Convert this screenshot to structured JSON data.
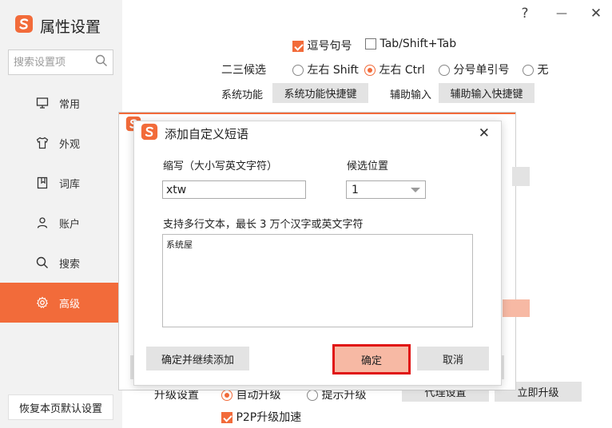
{
  "app": {
    "title": "属性设置",
    "help_glyph": "?",
    "minimize_glyph": "—",
    "close_glyph": "✕"
  },
  "sidebar": {
    "search_placeholder": "搜索设置项",
    "items": [
      {
        "label": "常用",
        "icon": "monitor-icon"
      },
      {
        "label": "外观",
        "icon": "shirt-icon"
      },
      {
        "label": "词库",
        "icon": "book-icon"
      },
      {
        "label": "账户",
        "icon": "person-icon"
      },
      {
        "label": "搜索",
        "icon": "search-icon"
      },
      {
        "label": "高级",
        "icon": "gear-icon"
      }
    ],
    "active_index": 5,
    "reset_label": "恢复本页默认设置"
  },
  "main": {
    "opt_comma_period": "逗号句号",
    "opt_tab_shift": "Tab/Shift+Tab",
    "candidate23_label": "二三候选",
    "radio_left_right_shift": "左右 Shift",
    "radio_left_right_ctrl": "左右 Ctrl",
    "radio_semicolon_quote": "分号单引号",
    "radio_none": "无",
    "sys_func_label": "系统功能",
    "sys_func_btn": "系统功能快捷键",
    "assist_input_label": "辅助输入",
    "assist_input_btn": "辅助输入快捷键",
    "upgrade_label": "升级设置",
    "upgrade_auto": "自动升级",
    "upgrade_prompt": "提示升级",
    "proxy_btn": "代理设置",
    "upgrade_now_btn": "立即升级",
    "p2p_label": "P2P升级加速"
  },
  "dialog": {
    "title": "添加自定义短语",
    "abbr_label": "缩写（大小写英文字符）",
    "abbr_value": "xtw",
    "position_label": "候选位置",
    "position_value": "1",
    "content_label": "支持多行文本，最长 3 万个汉字或英文字符",
    "content_value": "系统屋",
    "confirm_continue_btn": "确定并继续添加",
    "ok_btn": "确定",
    "cancel_btn": "取消",
    "close_glyph": "✕"
  },
  "colors": {
    "accent": "#f26b3a",
    "highlight_border": "#e01414",
    "primary_btn_bg": "#f7b9a4"
  }
}
